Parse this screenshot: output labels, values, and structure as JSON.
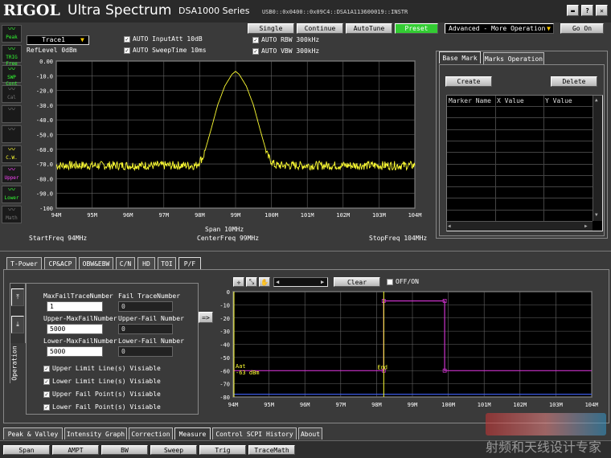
{
  "header": {
    "brand_rigol": "RIGOL",
    "brand_ultra": "Ultra",
    "brand_spectrum": "Spectrum",
    "brand_model": "DSA1000 Series",
    "device_id": "USB0::0x0400::0x09C4::DSA1A113600019::INSTR",
    "window_buttons": [
      "▬",
      "?",
      "✕"
    ]
  },
  "sidebar": [
    {
      "id": "peak",
      "label": "Peak",
      "color": "#33ff33"
    },
    {
      "id": "trig",
      "label": "TRIG Free",
      "color": "#33ff33"
    },
    {
      "id": "swp",
      "label": "SWP Cont",
      "color": "#33ff33"
    },
    {
      "id": "cal",
      "label": "Cal",
      "color": "#777777"
    },
    {
      "id": "unk1",
      "label": "",
      "color": "#777777"
    },
    {
      "id": "unk2",
      "label": "",
      "color": "#777777"
    },
    {
      "id": "cw",
      "label": "C.W.",
      "color": "#ffff33"
    },
    {
      "id": "upper",
      "label": "Upper",
      "color": "#ff44ff"
    },
    {
      "id": "lower",
      "label": "Lower",
      "color": "#33ff33"
    },
    {
      "id": "math",
      "label": "Math",
      "color": "#777777"
    }
  ],
  "top": {
    "trace_select": "Trace1",
    "ref_level": "RefLevel  0dBm",
    "auto_input_att": "AUTO InputAtt  10dB",
    "auto_sweep_time": "AUTO SweepTime  10ms",
    "auto_rbw": "AUTO RBW   300kHz",
    "auto_vbw": "AUTO VBW   300kHz",
    "single": "Single",
    "continue": "Continue",
    "autotune": "AutoTune",
    "preset": "Preset",
    "mode_select": "Advanced - More Operation",
    "go_on": "Go On"
  },
  "spectrum": {
    "y_ticks": [
      "0.00",
      "-10.0",
      "-20.0",
      "-30.0",
      "-40.0",
      "-50.0",
      "-60.0",
      "-70.0",
      "-80.0",
      "-90.0",
      "-100"
    ],
    "x_ticks": [
      "94M",
      "95M",
      "96M",
      "97M",
      "98M",
      "99M",
      "100M",
      "101M",
      "102M",
      "103M",
      "104M"
    ],
    "span": "Span  10MHz",
    "start_freq": "StartFreq  94MHz",
    "center_freq": "CenterFreq  99MHz",
    "stop_freq": "StopFreq  104MHz"
  },
  "chart_data": {
    "type": "line",
    "title": "",
    "xlabel": "",
    "ylabel": "",
    "x_unit": "MHz",
    "xlim": [
      94,
      104
    ],
    "ylim": [
      -100,
      0
    ],
    "series": [
      {
        "color": "#ffff33",
        "x": [
          94,
          96,
          97.5,
          97.9,
          98.1,
          98.3,
          98.5,
          98.7,
          98.9,
          99.0,
          99.1,
          99.3,
          99.5,
          99.7,
          99.9,
          100.1,
          100.5,
          102,
          104
        ],
        "values": [
          -71,
          -71,
          -71,
          -71,
          -65,
          -48,
          -30,
          -17,
          -9,
          -7,
          -9,
          -17,
          -30,
          -48,
          -65,
          -71,
          -71,
          -71,
          -71
        ]
      }
    ]
  },
  "marker_panel": {
    "tabs": [
      "Base Mark",
      "Marks Operation"
    ],
    "create": "Create",
    "delete": "Delete",
    "columns": [
      "Marker Name",
      "X Value",
      "Y Value"
    ]
  },
  "meas_tabs": [
    "T-Power",
    "CP&ACP",
    "OBW&EBW",
    "C/N",
    "HD",
    "TOI",
    "P/F"
  ],
  "pf": {
    "operation": "Operation",
    "max_fail_label": "MaxFailTraceNumber",
    "max_fail_value": "1",
    "fail_trace_label": "Fail TraceNumber",
    "fail_trace_value": "0",
    "upper_max_label": "Upper-MaxFailNumber",
    "upper_max_value": "5000",
    "upper_fail_label": "Upper-Fail Number",
    "upper_fail_value": "0",
    "lower_max_label": "Lower-MaxFailNumber",
    "lower_max_value": "5000",
    "lower_fail_label": "Lower-Fail Number",
    "lower_fail_value": "0",
    "checks": [
      "Upper Limit Line(s) Visiable",
      "Lower Limit Line(s) Visiable",
      "Upper Fail Point(s) Visiable",
      "Lower Fail Point(s) Visiable"
    ],
    "arrow": "=>",
    "clear": "Clear",
    "off_on": "OFF/ON"
  },
  "pf_chart": {
    "y_ticks": [
      "0",
      "-10",
      "-20",
      "-30",
      "-40",
      "-50",
      "-60",
      "-70",
      "-80"
    ],
    "x_ticks": [
      "94M",
      "95M",
      "96M",
      "97M",
      "98M",
      "99M",
      "100M",
      "101M",
      "102M",
      "103M",
      "104M"
    ],
    "marker_start": "Aat",
    "marker_start_val": "-63 dBm",
    "marker_end": "End"
  },
  "pf_chart_data": {
    "type": "line",
    "xlim": [
      94,
      104
    ],
    "ylim": [
      -80,
      0
    ],
    "series": [
      {
        "color": "#cc33cc",
        "x": [
          94,
          98.2,
          98.2,
          99.9,
          99.9,
          104
        ],
        "values": [
          -60,
          -60,
          -7,
          -7,
          -60,
          -60
        ]
      },
      {
        "color": "#4466ff",
        "x": [
          94,
          104
        ],
        "values": [
          -78,
          -78
        ]
      }
    ]
  },
  "bottom_tabs": [
    "Peak & Valley",
    "Intensity Graph",
    "Correction",
    "Measure",
    "Control SCPI History",
    "About"
  ],
  "footer_buttons": [
    "Span",
    "AMPT",
    "BW",
    "Sweep",
    "Trig",
    "TraceMath"
  ],
  "watermark": "射频和天线设计专家"
}
